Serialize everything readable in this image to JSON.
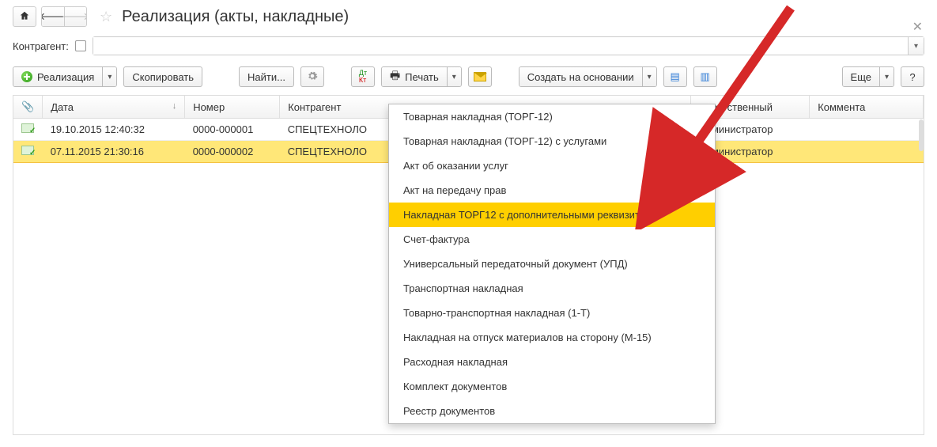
{
  "header": {
    "title": "Реализация (акты, накладные)"
  },
  "filter": {
    "label": "Контрагент:"
  },
  "toolbar": {
    "realize": "Реализация",
    "copy": "Скопировать",
    "find": "Найти...",
    "print": "Печать",
    "create_based": "Создать на основании",
    "more": "Еще",
    "help": "?"
  },
  "columns": {
    "attach": "📎",
    "date": "Дата",
    "number": "Номер",
    "counterparty": "Контрагент",
    "responsible": "Ответственный",
    "comment": "Коммента"
  },
  "rows": [
    {
      "date": "19.10.2015 12:40:32",
      "number": "0000-000001",
      "counterparty": "СПЕЦТЕХНОЛО",
      "responsible": "Администратор"
    },
    {
      "date": "07.11.2015 21:30:16",
      "number": "0000-000002",
      "counterparty": "СПЕЦТЕХНОЛО",
      "responsible": "Администратор"
    }
  ],
  "print_menu": [
    "Товарная накладная (ТОРГ-12)",
    "Товарная накладная (ТОРГ-12) с услугами",
    "Акт об оказании услуг",
    "Акт на передачу прав",
    "Накладная ТОРГ12 с дополнительными реквизитами",
    "Счет-фактура",
    "Универсальный передаточный документ (УПД)",
    "Транспортная накладная",
    "Товарно-транспортная накладная (1-Т)",
    "Накладная на отпуск материалов на сторону (М-15)",
    "Расходная накладная",
    "Комплект документов",
    "Реестр документов"
  ],
  "highlighted_menu_index": 4
}
